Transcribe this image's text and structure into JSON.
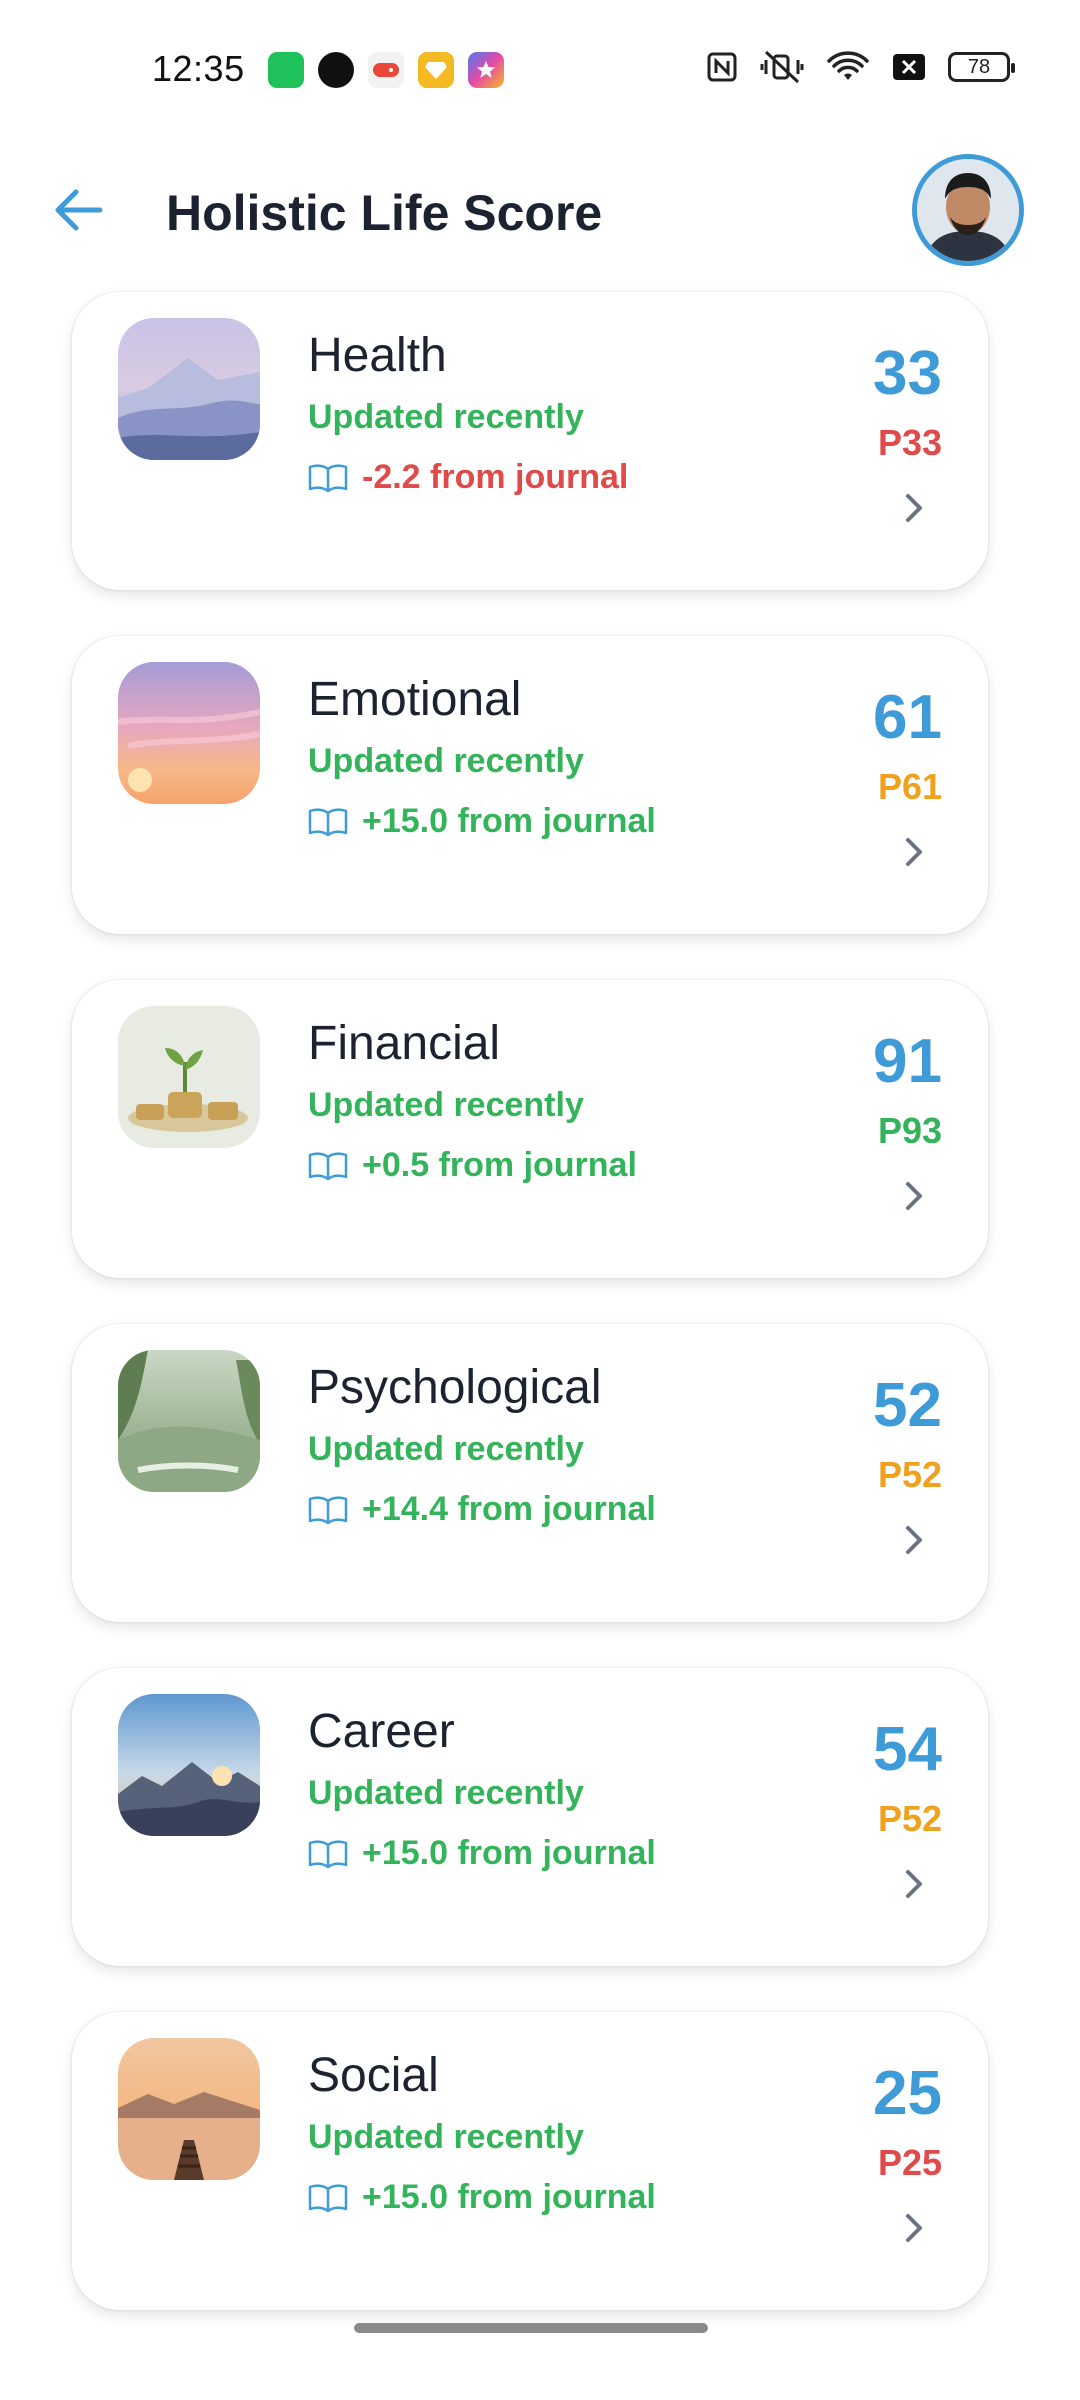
{
  "status_bar": {
    "time": "12:35",
    "battery": "78"
  },
  "header": {
    "title": "Holistic Life Score"
  },
  "colors": {
    "accent": "#3f9bd8",
    "positive": "#33b35a",
    "negative": "#e04a4a",
    "warning": "#f0a21e"
  },
  "cards": [
    {
      "name": "Health",
      "updated": "Updated recently",
      "journal": "-2.2 from journal",
      "journal_color": "#e04a4a",
      "score": "33",
      "percentile": "P33",
      "percentile_color": "#e04a4a"
    },
    {
      "name": "Emotional",
      "updated": "Updated recently",
      "journal": "+15.0 from journal",
      "journal_color": "#33b35a",
      "score": "61",
      "percentile": "P61",
      "percentile_color": "#f0a21e"
    },
    {
      "name": "Financial",
      "updated": "Updated recently",
      "journal": "+0.5 from journal",
      "journal_color": "#33b35a",
      "score": "91",
      "percentile": "P93",
      "percentile_color": "#33b35a"
    },
    {
      "name": "Psychological",
      "updated": "Updated recently",
      "journal": "+14.4 from journal",
      "journal_color": "#33b35a",
      "score": "52",
      "percentile": "P52",
      "percentile_color": "#f0a21e"
    },
    {
      "name": "Career",
      "updated": "Updated recently",
      "journal": "+15.0 from journal",
      "journal_color": "#33b35a",
      "score": "54",
      "percentile": "P52",
      "percentile_color": "#f0a21e"
    },
    {
      "name": "Social",
      "updated": "Updated recently",
      "journal": "+15.0 from journal",
      "journal_color": "#33b35a",
      "score": "25",
      "percentile": "P25",
      "percentile_color": "#e04a4a"
    }
  ]
}
